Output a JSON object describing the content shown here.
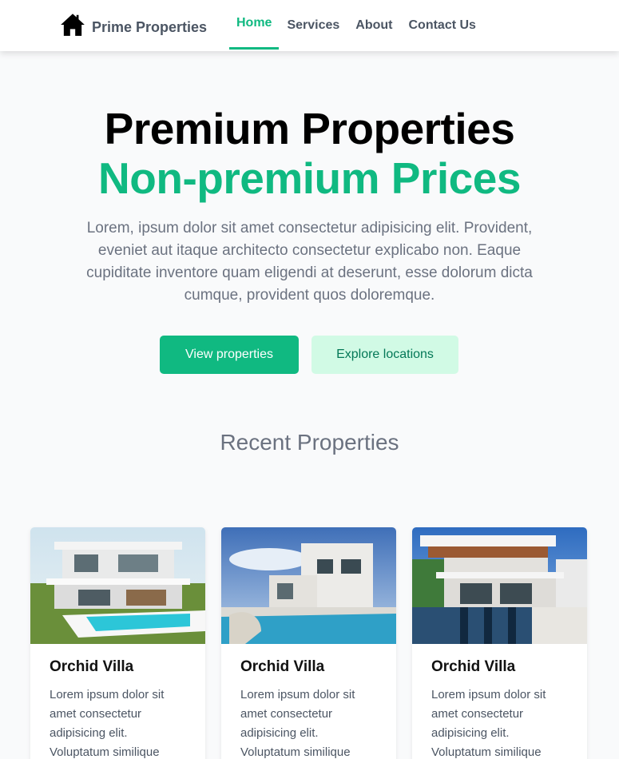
{
  "nav": {
    "brand": "Prime Properties",
    "brand_icon": "house-icon",
    "links": [
      "Home",
      "Services",
      "About",
      "Contact Us"
    ],
    "active": "Home",
    "accent": "#10b981"
  },
  "hero": {
    "title_line1": "Premium Properties",
    "title_line2": "Non-premium Prices",
    "description": "Lorem, ipsum dolor sit amet consectetur adipisicing elit. Provident, eveniet aut itaque architecto consectetur explicabo non. Eaque cupiditate inventore quam eligendi at deserunt, esse dolorum dicta cumque, provident quos doloremque.",
    "primary_button": "View properties",
    "secondary_button": "Explore locations"
  },
  "recent": {
    "title": "Recent Properties",
    "cards": [
      {
        "title": "Orchid Villa",
        "text": "Lorem ipsum dolor sit amet consectetur adipisicing elit. Voluptatum similique"
      },
      {
        "title": "Orchid Villa",
        "text": "Lorem ipsum dolor sit amet consectetur adipisicing elit. Voluptatum similique"
      },
      {
        "title": "Orchid Villa",
        "text": "Lorem ipsum dolor sit amet consectetur adipisicing elit. Voluptatum similique"
      }
    ]
  }
}
